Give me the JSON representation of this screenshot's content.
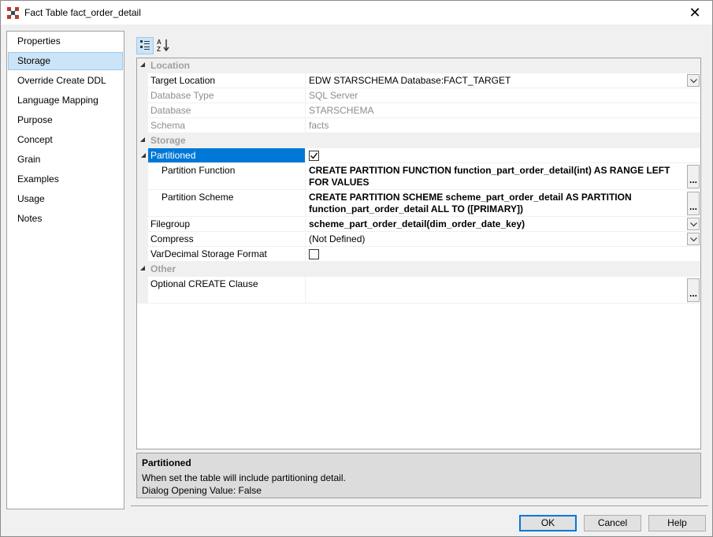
{
  "window": {
    "title": "Fact Table fact_order_detail",
    "close_label": "✕"
  },
  "nav": {
    "items": [
      {
        "label": "Properties"
      },
      {
        "label": "Storage",
        "selected": true
      },
      {
        "label": "Override Create DDL"
      },
      {
        "label": "Language Mapping"
      },
      {
        "label": "Purpose"
      },
      {
        "label": "Concept"
      },
      {
        "label": "Grain"
      },
      {
        "label": "Examples"
      },
      {
        "label": "Usage"
      },
      {
        "label": "Notes"
      }
    ]
  },
  "toolbar": {
    "categorized_icon": "categorized-icon",
    "alphabetical_icon": "sort-alphabetical-icon"
  },
  "grid": {
    "location": {
      "label": "Location",
      "target_location": {
        "name": "Target Location",
        "value": "EDW STARSCHEMA Database:FACT_TARGET"
      },
      "database_type": {
        "name": "Database Type",
        "value": "SQL Server"
      },
      "database": {
        "name": "Database",
        "value": "STARSCHEMA"
      },
      "schema": {
        "name": "Schema",
        "value": "facts"
      }
    },
    "storage": {
      "label": "Storage",
      "partitioned": {
        "name": "Partitioned",
        "checked": true
      },
      "partition_function": {
        "name": "Partition Function",
        "value": "CREATE PARTITION FUNCTION function_part_order_detail(int) AS RANGE LEFT FOR VALUES"
      },
      "partition_scheme": {
        "name": "Partition Scheme",
        "value": "CREATE PARTITION SCHEME scheme_part_order_detail AS PARTITION function_part_order_detail ALL TO ([PRIMARY])"
      },
      "filegroup": {
        "name": "Filegroup",
        "value": "scheme_part_order_detail(dim_order_date_key)"
      },
      "compress": {
        "name": "Compress",
        "value": "(Not Defined)"
      },
      "vardecimal": {
        "name": "VarDecimal Storage Format",
        "checked": false
      }
    },
    "other": {
      "label": "Other",
      "optional_create": {
        "name": "Optional CREATE Clause",
        "value": ""
      }
    },
    "ellipsis": "..."
  },
  "help": {
    "title": "Partitioned",
    "line1": "When set the table will include partitioning detail.",
    "line2": "Dialog Opening Value: False"
  },
  "buttons": {
    "ok": "OK",
    "cancel": "Cancel",
    "help": "Help"
  },
  "colors": {
    "selection": "#0078d7",
    "nav_selected": "#cce4f7"
  }
}
